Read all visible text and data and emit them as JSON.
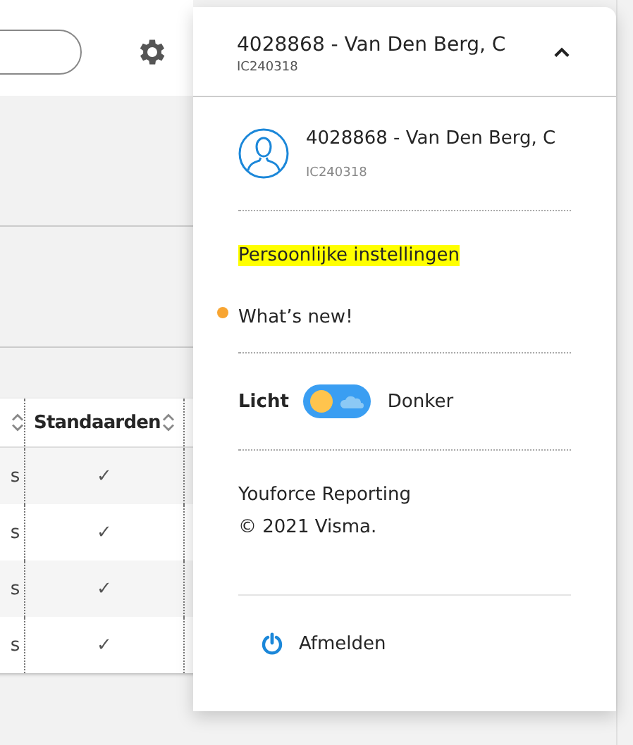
{
  "table": {
    "columns": [
      {
        "sortable": true
      },
      {
        "label": "Standaarden",
        "sortable": true
      }
    ],
    "rows": [
      {
        "column_1": "s",
        "standaarden": "✓"
      },
      {
        "column_1": "s",
        "standaarden": "✓"
      },
      {
        "column_1": "s",
        "standaarden": "✓"
      },
      {
        "column_1": "s",
        "standaarden": "✓"
      }
    ]
  },
  "user_menu": {
    "name": "4028868 - Van Den Berg, C",
    "code": "IC240318",
    "expanded": true,
    "profile": {
      "name": "4028868 - Van Den Berg, C",
      "code": "IC240318"
    },
    "links": [
      {
        "label": "Persoonlijke instellingen",
        "highlighted": true,
        "has_dot": false
      },
      {
        "label": "What’s new!",
        "highlighted": false,
        "has_dot": true
      }
    ],
    "theme": {
      "left_label": "Licht",
      "right_label": "Donker",
      "on": false
    },
    "about": [
      "Youforce Reporting",
      "© 2021 Visma."
    ],
    "logout": "Afmelden"
  }
}
